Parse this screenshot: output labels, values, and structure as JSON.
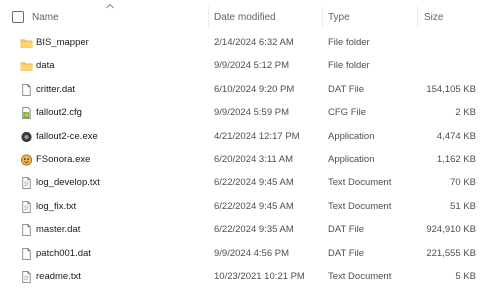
{
  "header": {
    "name": "Name",
    "date_modified": "Date modified",
    "type": "Type",
    "size": "Size"
  },
  "files": [
    {
      "icon": "folder-icon",
      "name": "BIS_mapper",
      "date": "2/14/2024 6:32 AM",
      "type": "File folder",
      "size": ""
    },
    {
      "icon": "folder-icon",
      "name": "data",
      "date": "9/9/2024 5:12 PM",
      "type": "File folder",
      "size": ""
    },
    {
      "icon": "file-icon",
      "name": "critter.dat",
      "date": "6/10/2024 9:20 PM",
      "type": "DAT File",
      "size": "154,105 KB"
    },
    {
      "icon": "config-file-icon",
      "name": "fallout2.cfg",
      "date": "9/9/2024 5:59 PM",
      "type": "CFG File",
      "size": "2 KB"
    },
    {
      "icon": "application-icon",
      "name": "fallout2-ce.exe",
      "date": "4/21/2024 12:17 PM",
      "type": "Application",
      "size": "4,474 KB"
    },
    {
      "icon": "application-face-icon",
      "name": "FSonora.exe",
      "date": "6/20/2024 3:11 AM",
      "type": "Application",
      "size": "1,162 KB"
    },
    {
      "icon": "text-document-icon",
      "name": "log_develop.txt",
      "date": "6/22/2024 9:45 AM",
      "type": "Text Document",
      "size": "70 KB"
    },
    {
      "icon": "text-document-icon",
      "name": "log_fix.txt",
      "date": "6/22/2024 9:45 AM",
      "type": "Text Document",
      "size": "51 KB"
    },
    {
      "icon": "file-icon",
      "name": "master.dat",
      "date": "6/22/2024 9:35 AM",
      "type": "DAT File",
      "size": "924,910 KB"
    },
    {
      "icon": "file-icon",
      "name": "patch001.dat",
      "date": "9/9/2024 4:56 PM",
      "type": "DAT File",
      "size": "221,555 KB"
    },
    {
      "icon": "text-document-icon",
      "name": "readme.txt",
      "date": "10/23/2021 10:21 PM",
      "type": "Text Document",
      "size": "5 KB"
    }
  ],
  "colors": {
    "folder": "#f4c44e",
    "text": "#1a1a1a",
    "muted": "#4b4f55"
  }
}
